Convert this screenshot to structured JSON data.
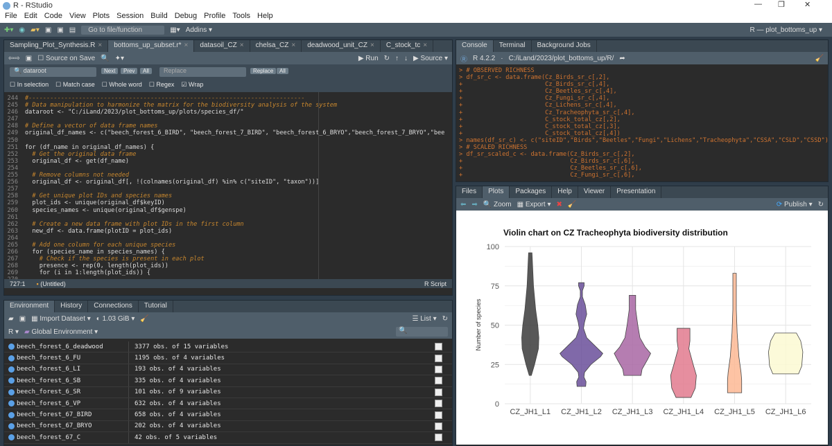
{
  "window": {
    "title": "R - RStudio",
    "project": "R — plot_bottoms_up"
  },
  "menu": [
    "File",
    "Edit",
    "Code",
    "View",
    "Plots",
    "Session",
    "Build",
    "Debug",
    "Profile",
    "Tools",
    "Help"
  ],
  "toolbar": {
    "goto": "Go to file/function",
    "addins": "Addins"
  },
  "editor": {
    "tabs": [
      "Sampling_Plot_Synthesis.R",
      "bottoms_up_subset.r*",
      "datasoil_CZ",
      "chelsa_CZ",
      "deadwood_unit_CZ",
      "C_stock_tc"
    ],
    "active_tab": 1,
    "source_on_save": "Source on Save",
    "run": "Run",
    "source": "Source",
    "find": {
      "value": "dataroot",
      "next": "Next",
      "prev": "Prev",
      "all": "All",
      "replace_placeholder": "Replace",
      "replace": "Replace",
      "replace_all": "All",
      "options": [
        {
          "label": "In selection",
          "checked": false
        },
        {
          "label": "Match case",
          "checked": false
        },
        {
          "label": "Whole word",
          "checked": false
        },
        {
          "label": "Regex",
          "checked": false
        },
        {
          "label": "Wrap",
          "checked": true
        }
      ]
    },
    "lines": [
      {
        "n": "244",
        "t": "#-----------------------------------------------------------------------------",
        "c": true
      },
      {
        "n": "245",
        "t": "# Data manipulation to harmonize the matrix for the biodiversity analysis of the system",
        "c": true
      },
      {
        "n": "246",
        "t": "dataroot <- \"C:/iLand/2023/plot_bottoms_up/plots/species_df/\"",
        "c": false
      },
      {
        "n": "247",
        "t": "",
        "c": false
      },
      {
        "n": "248",
        "t": "# Define a vector of data frame names",
        "c": true
      },
      {
        "n": "249",
        "t": "original_df_names <- c(\"beech_forest_6_BIRD\", \"beech_forest_7_BIRD\", \"beech_forest_6_BRYO\",\"beech_forest_7_BRYO\",\"bee",
        "c": false
      },
      {
        "n": "250",
        "t": "",
        "c": false
      },
      {
        "n": "251",
        "t": "for (df_name in original_df_names) {",
        "c": false
      },
      {
        "n": "252",
        "t": "  # Get the original data frame",
        "c": true
      },
      {
        "n": "253",
        "t": "  original_df <- get(df_name)",
        "c": false
      },
      {
        "n": "254",
        "t": "",
        "c": false
      },
      {
        "n": "255",
        "t": "  # Remove columns not needed",
        "c": true
      },
      {
        "n": "256",
        "t": "  original_df <- original_df[, !(colnames(original_df) %in% c(\"siteID\", \"taxon\"))]",
        "c": false
      },
      {
        "n": "257",
        "t": "",
        "c": false
      },
      {
        "n": "258",
        "t": "  # Get unique plot IDs and species names",
        "c": true
      },
      {
        "n": "259",
        "t": "  plot_ids <- unique(original_df$keyID)",
        "c": false
      },
      {
        "n": "260",
        "t": "  species_names <- unique(original_df$genspe)",
        "c": false
      },
      {
        "n": "261",
        "t": "",
        "c": false
      },
      {
        "n": "262",
        "t": "  # Create a new data frame with plot IDs in the first column",
        "c": true
      },
      {
        "n": "263",
        "t": "  new_df <- data.frame(plotID = plot_ids)",
        "c": false
      },
      {
        "n": "264",
        "t": "",
        "c": false
      },
      {
        "n": "265",
        "t": "  # Add one column for each unique species",
        "c": true
      },
      {
        "n": "266",
        "t": "  for (species_name in species_names) {",
        "c": false
      },
      {
        "n": "267",
        "t": "    # Check if the species is present in each plot",
        "c": true
      },
      {
        "n": "268",
        "t": "    presence <- rep(0, length(plot_ids))",
        "c": false
      },
      {
        "n": "269",
        "t": "    for (i in 1:length(plot_ids)) {",
        "c": false
      },
      {
        "n": "270",
        "t": "",
        "c": false
      }
    ],
    "status": {
      "pos": "727:1",
      "scope": "(Untitled)",
      "type": "R Script"
    }
  },
  "console": {
    "tabs": [
      "Console",
      "Terminal",
      "Background Jobs"
    ],
    "version": "R 4.2.2",
    "path": "C:/iLand/2023/plot_bottoms_up/R/",
    "lines": [
      "> # OBSERVED RICHNESS",
      "> df_sr_c <- data.frame(Cz_Birds_sr_c[,2],",
      "+                       Cz_Birds_sr_c[,4],",
      "+                       Cz_Beetles_sr_c[,4],",
      "+                       Cz_Fungi_sr_c[,4],",
      "+                       Cz_Lichens_sr_c[,4],",
      "+                       Cz_Tracheophyta_sr_c[,4],",
      "+                       C_stock_total_cz[,2],",
      "+                       C_stock_total_cz[,3],",
      "+                       C_stock_total_cz[,4])",
      "> names(df_sr_c) <- c(\"siteID\",\"Birds\",\"Beetles\",\"Fungi\",\"Lichens\",\"Tracheophyta\",\"CSSA\",\"CSLD\",\"CSSD\")",
      "> # SCALED RICHNESS",
      "> df_sr_scaled_c <- data.frame(Cz_Birds_sr_c[,2],",
      "+                              Cz_Birds_sr_c[,6],",
      "+                              Cz_Beetles_sr_c[,6],",
      "+                              Cz_Fungi_sr_c[,6],"
    ]
  },
  "environment": {
    "tabs": [
      "Environment",
      "History",
      "Connections",
      "Tutorial"
    ],
    "import": "Import Dataset",
    "memory": "1.03 GiB",
    "view": "List",
    "lang": "R",
    "scope": "Global Environment",
    "rows": [
      {
        "name": "beech_forest_6_deadwood",
        "value": "3377 obs. of 15 variables"
      },
      {
        "name": "beech_forest_6_FU",
        "value": "1195 obs. of 4 variables"
      },
      {
        "name": "beech_forest_6_LI",
        "value": "193 obs. of 4 variables"
      },
      {
        "name": "beech_forest_6_SB",
        "value": "335 obs. of 4 variables"
      },
      {
        "name": "beech_forest_6_SR",
        "value": "101 obs. of 9 variables"
      },
      {
        "name": "beech_forest_6_VP",
        "value": "632 obs. of 4 variables"
      },
      {
        "name": "beech_forest_67_BIRD",
        "value": "658 obs. of 4 variables"
      },
      {
        "name": "beech_forest_67_BRYO",
        "value": "202 obs. of 4 variables"
      },
      {
        "name": "beech_forest_67_C",
        "value": "42 obs. of 5 variables"
      }
    ]
  },
  "plots_pane": {
    "tabs": [
      "Files",
      "Plots",
      "Packages",
      "Help",
      "Viewer",
      "Presentation"
    ],
    "active_tab": 1,
    "zoom": "Zoom",
    "export": "Export",
    "publish": "Publish"
  },
  "chart_data": {
    "type": "violin",
    "title": "Violin chart on CZ Tracheophyta biodiversity distribution",
    "xlabel": "",
    "ylabel": "Number of species",
    "ylim": [
      0,
      100
    ],
    "yticks": [
      0,
      25,
      50,
      75,
      100
    ],
    "grid": true,
    "categories": [
      "CZ_JH1_L1",
      "CZ_JH1_L2",
      "CZ_JH1_L3",
      "CZ_JH1_L4",
      "CZ_JH1_L5",
      "CZ_JH1_L6"
    ],
    "colors": [
      "#3b3b3b",
      "#6a4f9a",
      "#a866a3",
      "#e27a8e",
      "#fdb894",
      "#fcf9d2"
    ],
    "violins": [
      [
        [
          18,
          0.05
        ],
        [
          25,
          0.2
        ],
        [
          35,
          0.38
        ],
        [
          42,
          0.4
        ],
        [
          50,
          0.35
        ],
        [
          60,
          0.25
        ],
        [
          75,
          0.15
        ],
        [
          90,
          0.1
        ],
        [
          96,
          0.08
        ]
      ],
      [
        [
          11,
          0.2
        ],
        [
          14,
          0.22
        ],
        [
          17,
          0.12
        ],
        [
          20,
          0.15
        ],
        [
          25,
          0.45
        ],
        [
          30,
          0.9
        ],
        [
          32,
          1.0
        ],
        [
          36,
          0.7
        ],
        [
          42,
          0.25
        ],
        [
          48,
          0.1
        ],
        [
          52,
          0.15
        ],
        [
          57,
          0.25
        ],
        [
          63,
          0.18
        ],
        [
          68,
          0.05
        ],
        [
          72,
          0.05
        ],
        [
          75,
          0.13
        ],
        [
          77,
          0.13
        ]
      ],
      [
        [
          18,
          0.4
        ],
        [
          22,
          0.45
        ],
        [
          28,
          0.7
        ],
        [
          32,
          0.85
        ],
        [
          36,
          0.6
        ],
        [
          42,
          0.35
        ],
        [
          50,
          0.25
        ],
        [
          60,
          0.15
        ],
        [
          66,
          0.15
        ],
        [
          69,
          0.15
        ]
      ],
      [
        [
          4,
          0.35
        ],
        [
          10,
          0.55
        ],
        [
          18,
          0.6
        ],
        [
          25,
          0.45
        ],
        [
          35,
          0.25
        ],
        [
          40,
          0.3
        ],
        [
          48,
          0.3
        ]
      ],
      [
        [
          7,
          0.33
        ],
        [
          15,
          0.33
        ],
        [
          20,
          0.3
        ],
        [
          30,
          0.2
        ],
        [
          45,
          0.12
        ],
        [
          60,
          0.08
        ],
        [
          75,
          0.08
        ],
        [
          83,
          0.08
        ]
      ],
      [
        [
          19,
          0.6
        ],
        [
          24,
          0.75
        ],
        [
          33,
          0.8
        ],
        [
          40,
          0.7
        ],
        [
          45,
          0.5
        ]
      ]
    ]
  }
}
